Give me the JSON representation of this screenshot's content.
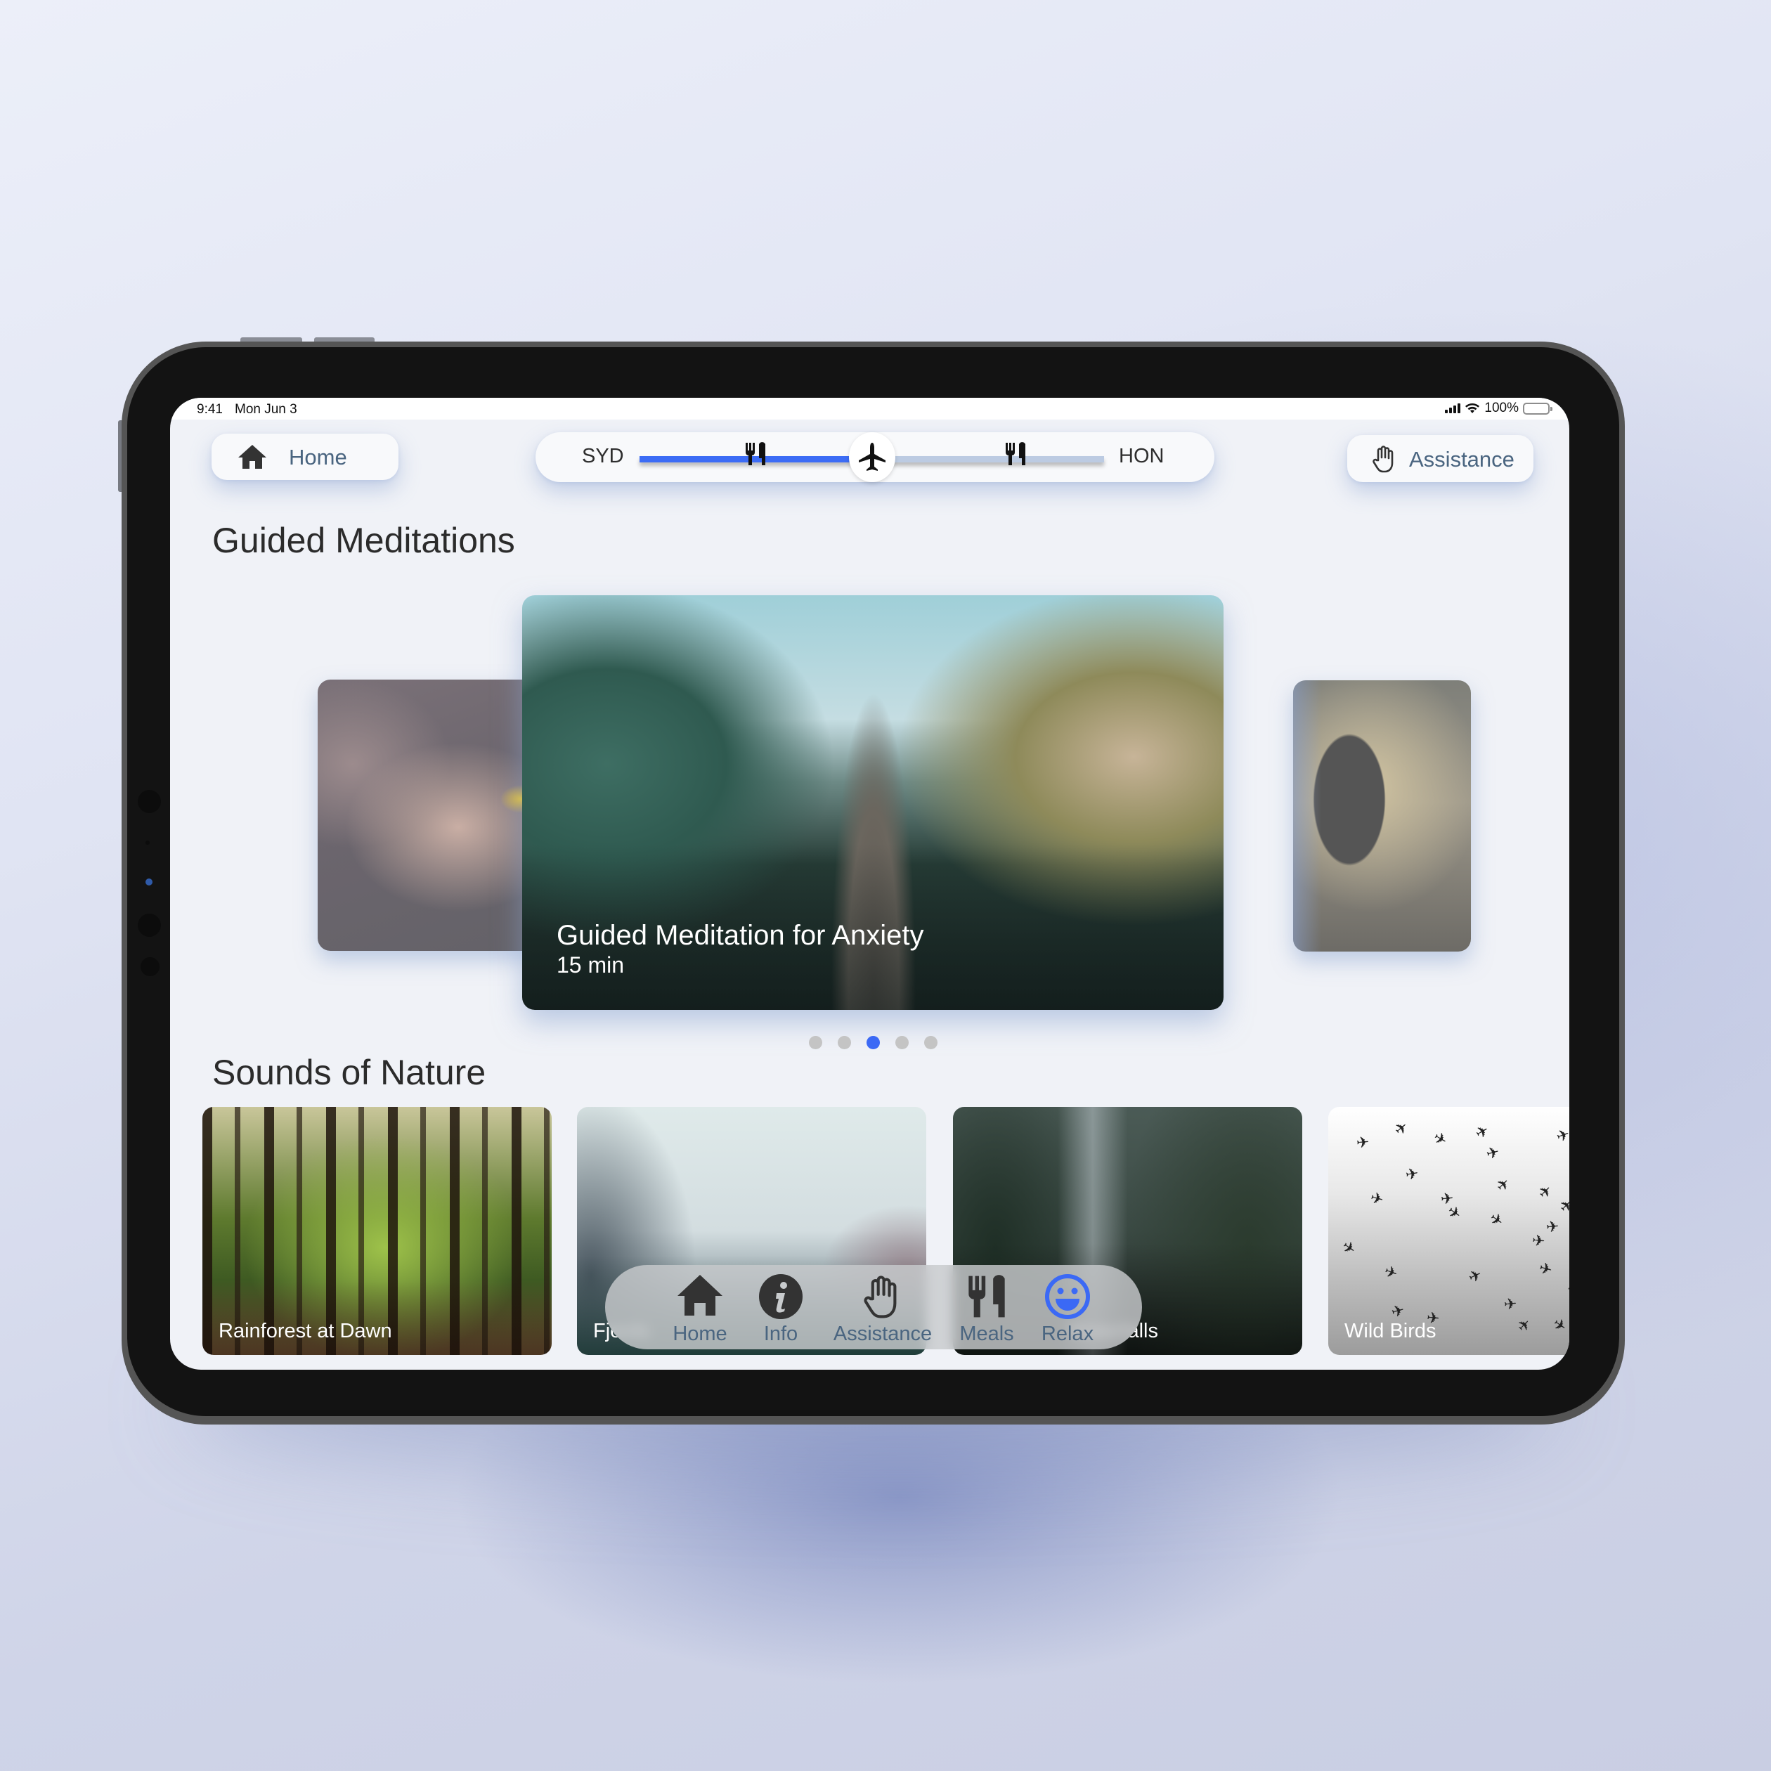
{
  "status_bar": {
    "time": "9:41",
    "date": "Mon Jun 3",
    "battery": "100%"
  },
  "header": {
    "home_button": {
      "label": "Home",
      "icon": "home-icon"
    },
    "flight_progress": {
      "origin": "SYD",
      "destination": "HON",
      "progress": 0.5,
      "meal_markers": [
        0.25,
        0.81
      ],
      "colors": {
        "progress": "#3c6cf5",
        "remaining": "#bccbe2"
      }
    },
    "assistance_button": {
      "label": "Assistance",
      "icon": "hand-icon"
    }
  },
  "guided_meditations": {
    "title": "Guided Meditations",
    "featured": {
      "title": "Guided Meditation for Anxiety",
      "duration": "15 min"
    },
    "page_count": 5,
    "active_page": 3,
    "active_color": "#3b69f5"
  },
  "sounds_of_nature": {
    "title": "Sounds of Nature",
    "cards": [
      {
        "label": "Rainforest at Dawn"
      },
      {
        "label": "Fjords"
      },
      {
        "label": "Waterfalls"
      },
      {
        "label": "Wild Birds"
      }
    ]
  },
  "bottom_nav": {
    "items": [
      {
        "label": "Home",
        "icon": "home-icon",
        "active": false
      },
      {
        "label": "Info",
        "icon": "info-icon",
        "active": false
      },
      {
        "label": "Assistance",
        "icon": "hand-icon",
        "active": false
      },
      {
        "label": "Meals",
        "icon": "utensils-icon",
        "active": false
      },
      {
        "label": "Relax",
        "icon": "smiley-icon",
        "active": true
      }
    ],
    "active_color": "#3b69f5"
  }
}
